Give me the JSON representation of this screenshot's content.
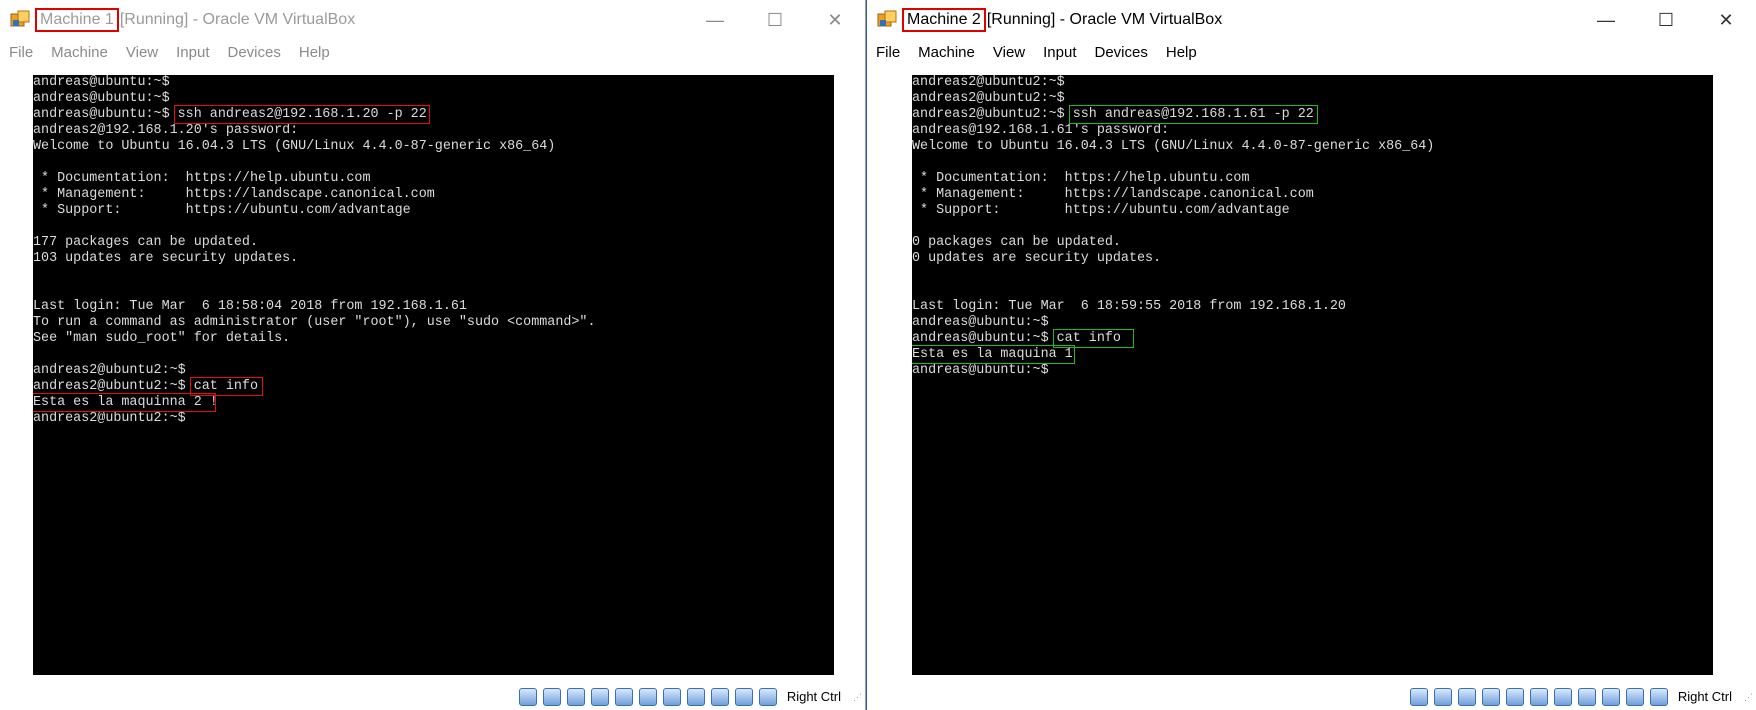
{
  "windows": [
    {
      "title_name": "Machine 1",
      "title_rest": " [Running] - Oracle VM VirtualBox",
      "menu": [
        "File",
        "Machine",
        "View",
        "Input",
        "Devices",
        "Help"
      ],
      "terminal": [
        "andreas@ubuntu:~$",
        "andreas@ubuntu:~$",
        "andreas@ubuntu:~$ ssh andreas2@192.168.1.20 -p 22",
        "andreas2@192.168.1.20's password:",
        "Welcome to Ubuntu 16.04.3 LTS (GNU/Linux 4.4.0-87-generic x86_64)",
        "",
        " * Documentation:  https://help.ubuntu.com",
        " * Management:     https://landscape.canonical.com",
        " * Support:        https://ubuntu.com/advantage",
        "",
        "177 packages can be updated.",
        "103 updates are security updates.",
        "",
        "",
        "Last login: Tue Mar  6 18:58:04 2018 from 192.168.1.61",
        "To run a command as administrator (user \"root\"), use \"sudo <command>\".",
        "See \"man sudo_root\" for details.",
        "",
        "andreas2@ubuntu2:~$",
        "andreas2@ubuntu2:~$ cat info",
        "Esta es la maquinna 2 !",
        "andreas2@ubuntu2:~$"
      ],
      "host_key": "Right Ctrl"
    },
    {
      "title_name": "Machine 2",
      "title_rest": " [Running] - Oracle VM VirtualBox",
      "menu": [
        "File",
        "Machine",
        "View",
        "Input",
        "Devices",
        "Help"
      ],
      "terminal": [
        "andreas2@ubuntu2:~$",
        "andreas2@ubuntu2:~$",
        "andreas2@ubuntu2:~$ ssh andreas@192.168.1.61 -p 22",
        "andreas@192.168.1.61's password:",
        "Welcome to Ubuntu 16.04.3 LTS (GNU/Linux 4.4.0-87-generic x86_64)",
        "",
        " * Documentation:  https://help.ubuntu.com",
        " * Management:     https://landscape.canonical.com",
        " * Support:        https://ubuntu.com/advantage",
        "",
        "0 packages can be updated.",
        "0 updates are security updates.",
        "",
        "",
        "Last login: Tue Mar  6 18:59:55 2018 from 192.168.1.20",
        "andreas@ubuntu:~$",
        "andreas@ubuntu:~$ cat info",
        "Esta es la maquina 1",
        "andreas@ubuntu:~$"
      ],
      "host_key": "Right Ctrl"
    }
  ],
  "window_controls": {
    "minimize": "—",
    "maximize": "☐",
    "close": "✕"
  },
  "colors": {
    "highlight_machine1": "#e01010",
    "highlight_machine2": "#22b822",
    "terminal_bg": "#000000",
    "terminal_text": "#dcdcdc"
  },
  "status_icons": [
    "hard-disk-icon",
    "optical-drive-icon",
    "audio-icon",
    "network-icon",
    "usb-icon",
    "shared-folders-icon",
    "display-icon",
    "video-capture-icon",
    "virtualization-icon",
    "mouse-integration-icon",
    "host-key-arrow-icon"
  ]
}
